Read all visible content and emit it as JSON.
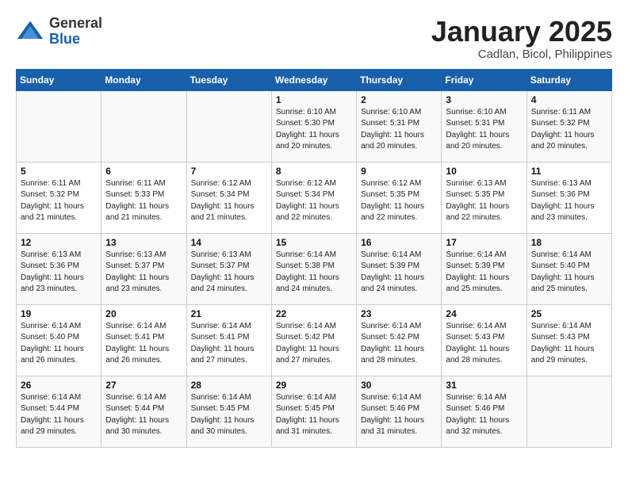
{
  "header": {
    "logo_general": "General",
    "logo_blue": "Blue",
    "title": "January 2025",
    "subtitle": "Cadlan, Bicol, Philippines"
  },
  "days_of_week": [
    "Sunday",
    "Monday",
    "Tuesday",
    "Wednesday",
    "Thursday",
    "Friday",
    "Saturday"
  ],
  "weeks": [
    [
      {
        "day": "",
        "info": ""
      },
      {
        "day": "",
        "info": ""
      },
      {
        "day": "",
        "info": ""
      },
      {
        "day": "1",
        "info": "Sunrise: 6:10 AM\nSunset: 5:30 PM\nDaylight: 11 hours and 20 minutes."
      },
      {
        "day": "2",
        "info": "Sunrise: 6:10 AM\nSunset: 5:31 PM\nDaylight: 11 hours and 20 minutes."
      },
      {
        "day": "3",
        "info": "Sunrise: 6:10 AM\nSunset: 5:31 PM\nDaylight: 11 hours and 20 minutes."
      },
      {
        "day": "4",
        "info": "Sunrise: 6:11 AM\nSunset: 5:32 PM\nDaylight: 11 hours and 20 minutes."
      }
    ],
    [
      {
        "day": "5",
        "info": "Sunrise: 6:11 AM\nSunset: 5:32 PM\nDaylight: 11 hours and 21 minutes."
      },
      {
        "day": "6",
        "info": "Sunrise: 6:11 AM\nSunset: 5:33 PM\nDaylight: 11 hours and 21 minutes."
      },
      {
        "day": "7",
        "info": "Sunrise: 6:12 AM\nSunset: 5:34 PM\nDaylight: 11 hours and 21 minutes."
      },
      {
        "day": "8",
        "info": "Sunrise: 6:12 AM\nSunset: 5:34 PM\nDaylight: 11 hours and 22 minutes."
      },
      {
        "day": "9",
        "info": "Sunrise: 6:12 AM\nSunset: 5:35 PM\nDaylight: 11 hours and 22 minutes."
      },
      {
        "day": "10",
        "info": "Sunrise: 6:13 AM\nSunset: 5:35 PM\nDaylight: 11 hours and 22 minutes."
      },
      {
        "day": "11",
        "info": "Sunrise: 6:13 AM\nSunset: 5:36 PM\nDaylight: 11 hours and 23 minutes."
      }
    ],
    [
      {
        "day": "12",
        "info": "Sunrise: 6:13 AM\nSunset: 5:36 PM\nDaylight: 11 hours and 23 minutes."
      },
      {
        "day": "13",
        "info": "Sunrise: 6:13 AM\nSunset: 5:37 PM\nDaylight: 11 hours and 23 minutes."
      },
      {
        "day": "14",
        "info": "Sunrise: 6:13 AM\nSunset: 5:37 PM\nDaylight: 11 hours and 24 minutes."
      },
      {
        "day": "15",
        "info": "Sunrise: 6:14 AM\nSunset: 5:38 PM\nDaylight: 11 hours and 24 minutes."
      },
      {
        "day": "16",
        "info": "Sunrise: 6:14 AM\nSunset: 5:39 PM\nDaylight: 11 hours and 24 minutes."
      },
      {
        "day": "17",
        "info": "Sunrise: 6:14 AM\nSunset: 5:39 PM\nDaylight: 11 hours and 25 minutes."
      },
      {
        "day": "18",
        "info": "Sunrise: 6:14 AM\nSunset: 5:40 PM\nDaylight: 11 hours and 25 minutes."
      }
    ],
    [
      {
        "day": "19",
        "info": "Sunrise: 6:14 AM\nSunset: 5:40 PM\nDaylight: 11 hours and 26 minutes."
      },
      {
        "day": "20",
        "info": "Sunrise: 6:14 AM\nSunset: 5:41 PM\nDaylight: 11 hours and 26 minutes."
      },
      {
        "day": "21",
        "info": "Sunrise: 6:14 AM\nSunset: 5:41 PM\nDaylight: 11 hours and 27 minutes."
      },
      {
        "day": "22",
        "info": "Sunrise: 6:14 AM\nSunset: 5:42 PM\nDaylight: 11 hours and 27 minutes."
      },
      {
        "day": "23",
        "info": "Sunrise: 6:14 AM\nSunset: 5:42 PM\nDaylight: 11 hours and 28 minutes."
      },
      {
        "day": "24",
        "info": "Sunrise: 6:14 AM\nSunset: 5:43 PM\nDaylight: 11 hours and 28 minutes."
      },
      {
        "day": "25",
        "info": "Sunrise: 6:14 AM\nSunset: 5:43 PM\nDaylight: 11 hours and 29 minutes."
      }
    ],
    [
      {
        "day": "26",
        "info": "Sunrise: 6:14 AM\nSunset: 5:44 PM\nDaylight: 11 hours and 29 minutes."
      },
      {
        "day": "27",
        "info": "Sunrise: 6:14 AM\nSunset: 5:44 PM\nDaylight: 11 hours and 30 minutes."
      },
      {
        "day": "28",
        "info": "Sunrise: 6:14 AM\nSunset: 5:45 PM\nDaylight: 11 hours and 30 minutes."
      },
      {
        "day": "29",
        "info": "Sunrise: 6:14 AM\nSunset: 5:45 PM\nDaylight: 11 hours and 31 minutes."
      },
      {
        "day": "30",
        "info": "Sunrise: 6:14 AM\nSunset: 5:46 PM\nDaylight: 11 hours and 31 minutes."
      },
      {
        "day": "31",
        "info": "Sunrise: 6:14 AM\nSunset: 5:46 PM\nDaylight: 11 hours and 32 minutes."
      },
      {
        "day": "",
        "info": ""
      }
    ]
  ]
}
